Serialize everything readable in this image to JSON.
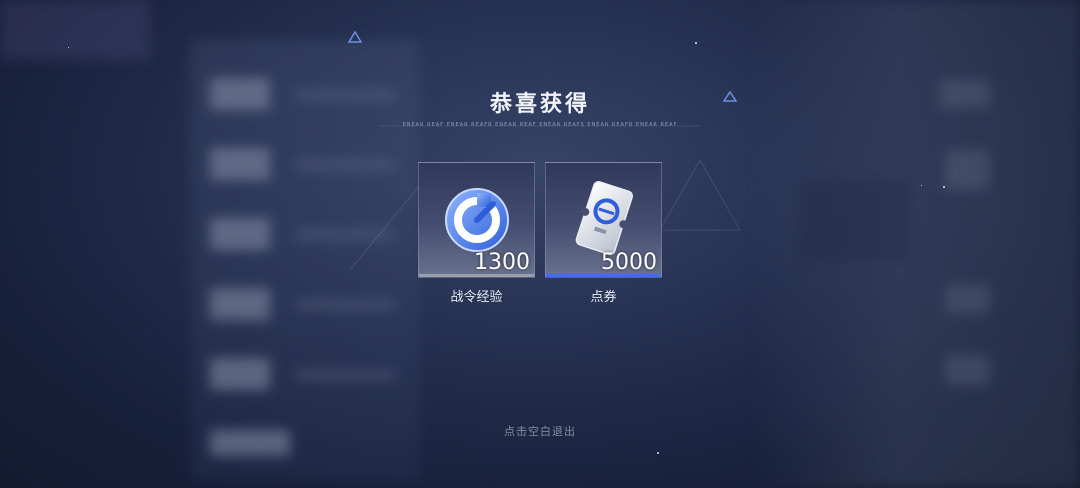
{
  "dialog": {
    "title": "恭喜获得",
    "subtitle": "ENEAR REAF ENEAR REAFR ENEAR REAF ENEAR REAFS ENEAR REAFR ENEAR REAF"
  },
  "rewards": [
    {
      "name": "战令经验",
      "amount": "1300",
      "icon": "battle-pass-exp-icon",
      "accent": "#9aa0aa"
    },
    {
      "name": "点券",
      "amount": "5000",
      "icon": "coupon-ticket-icon",
      "accent": "#3f6fe0"
    }
  ],
  "exit_hint": "点击空白退出"
}
